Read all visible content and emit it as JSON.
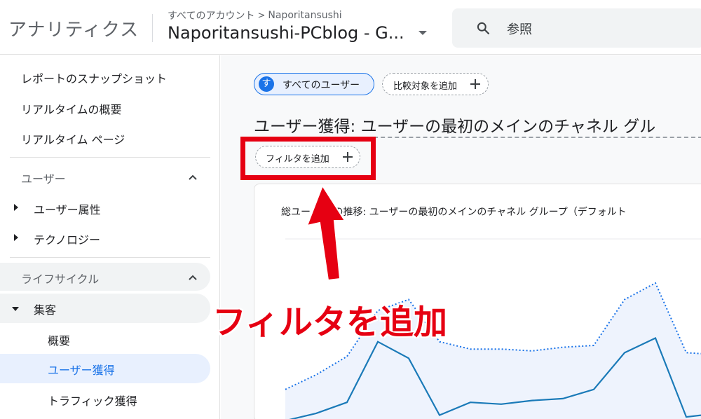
{
  "header": {
    "app_title": "アナリティクス",
    "breadcrumb_parent": "すべてのアカウント",
    "breadcrumb_separator": ">",
    "breadcrumb_child": "Naporitansushi",
    "property_name": "Naporitansushi-PCblog - G...",
    "search_label": "参照"
  },
  "sidebar": {
    "links": [
      "レポートのスナップショット",
      "リアルタイムの概要",
      "リアルタイム ページ"
    ],
    "sections": {
      "user": {
        "label": "ユーザー",
        "items": [
          "ユーザー属性",
          "テクノロジー"
        ]
      },
      "lifecycle": {
        "label": "ライフサイクル",
        "group": "集客",
        "sub_items": [
          "概要",
          "ユーザー獲得",
          "トラフィック獲得"
        ],
        "active_item": "ユーザー獲得"
      }
    }
  },
  "main": {
    "segment_chip": {
      "avatar_letter": "す",
      "label": "すべてのユーザー"
    },
    "compare_chip_label": "比較対象を追加",
    "report_title": "ユーザー獲得: ユーザーの最初のメインのチャネル グル",
    "filter_chip_label": "フィルタを追加",
    "chart_title": "総ユー　数 の推移: ユーザーの最初のメインのチャネル グループ（デフォルト"
  },
  "annotation": {
    "callout_text": "フィルタを追加",
    "highlight_color": "#e60012"
  },
  "colors": {
    "accent": "#1a73e8",
    "series_solid": "#1a7ab8",
    "series_dotted": "#1a73e8",
    "area_fill": "#eef3fd"
  },
  "chart_data": {
    "type": "line",
    "title": "総ユー　数 の推移: ユーザーの最初のメインのチャネル グループ（デフォルト",
    "xlabel": "",
    "ylabel": "",
    "series": [
      {
        "values": [
          0.18,
          0.26,
          0.36,
          0.61,
          0.67,
          0.44,
          0.4,
          0.4,
          0.39,
          0.41,
          0.42,
          0.67,
          0.76,
          0.38,
          0.37
        ]
      },
      {
        "values": [
          0.01,
          0.05,
          0.11,
          0.44,
          0.35,
          0.04,
          0.11,
          0.1,
          0.12,
          0.13,
          0.18,
          0.38,
          0.46,
          0.03,
          0.05
        ]
      }
    ]
  }
}
